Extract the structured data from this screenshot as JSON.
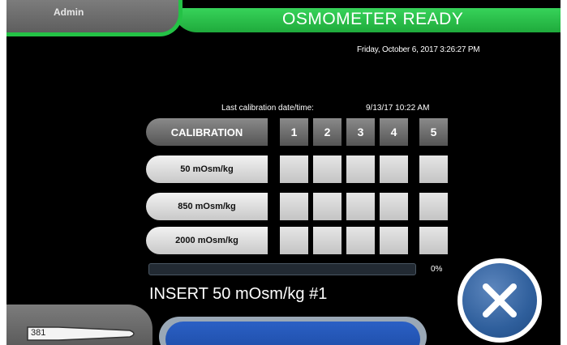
{
  "header": {
    "user_label": "Admin",
    "status": "OSMOMETER READY",
    "datetime": "Friday, October 6, 2017 3:26:27 PM"
  },
  "calibration": {
    "last_label": "Last calibration date/time:",
    "last_value": "9/13/17 10:22 AM",
    "header_label": "CALIBRATION",
    "columns": [
      "1",
      "2",
      "3",
      "4",
      "5"
    ],
    "standards": [
      {
        "label": "50 mOsm/kg"
      },
      {
        "label": "850 mOsm/kg"
      },
      {
        "label": "2000 mOsm/kg"
      }
    ]
  },
  "progress": {
    "value_percent": 0,
    "label": "0%"
  },
  "instruction": "INSERT 50 mOsm/kg #1",
  "sample": {
    "count_label": "381"
  },
  "colors": {
    "status_green": "#22b848",
    "close_blue": "#2f5f9c",
    "progress_track": "#222a33"
  },
  "icons": {
    "close": "close-x-icon",
    "sample_tube": "sample-tube-icon"
  }
}
